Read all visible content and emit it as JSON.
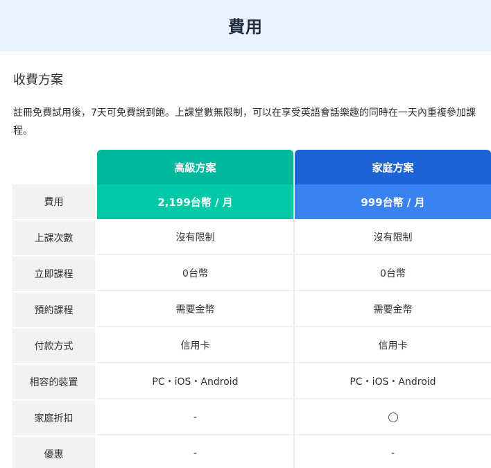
{
  "header": {
    "title": "費用"
  },
  "section": {
    "title": "收費方案",
    "description": "註冊免費試用後，7天可免費說到飽。上課堂數無限制，可以在享受英語會話樂趣的同時在一天內重複參加課程。"
  },
  "plans": [
    {
      "name": "高級方案",
      "color": "#00b89c",
      "price_color": "#00c9a7"
    },
    {
      "name": "家庭方案",
      "color": "#1e63d6",
      "price_color": "#3a82f0"
    }
  ],
  "rows": [
    {
      "label": "費用",
      "values": [
        "2,199台幣 / 月",
        "999台幣 / 月"
      ]
    },
    {
      "label": "上課次數",
      "values": [
        "沒有限制",
        "沒有限制"
      ]
    },
    {
      "label": "立即課程",
      "values": [
        "0台幣",
        "0台幣"
      ]
    },
    {
      "label": "預約課程",
      "values": [
        "需要金幣",
        "需要金幣"
      ]
    },
    {
      "label": "付款方式",
      "values": [
        "信用卡",
        "信用卡"
      ]
    },
    {
      "label": "相容的裝置",
      "values": [
        "PC・iOS・Android",
        "PC・iOS・Android"
      ]
    },
    {
      "label": "家庭折扣",
      "values": [
        "-",
        "circle-icon"
      ]
    },
    {
      "label": "優惠",
      "values": [
        "-",
        "-"
      ]
    }
  ]
}
